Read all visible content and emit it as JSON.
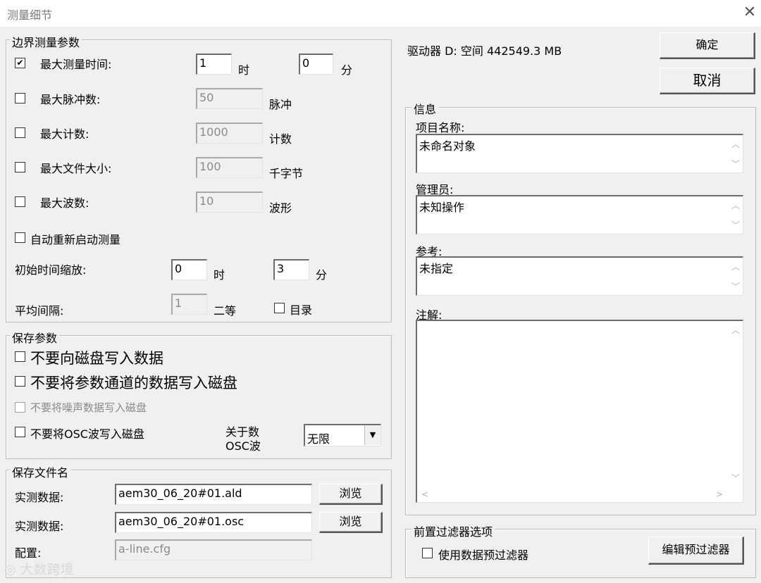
{
  "window": {
    "title": "测量细节",
    "close_icon": "close-icon"
  },
  "boundary": {
    "legend": "边界测量参数",
    "max_time": {
      "label": "最大测量时间:",
      "checked": true,
      "hours": "1",
      "hours_unit": "时",
      "minutes": "0",
      "minutes_unit": "分"
    },
    "max_pulses": {
      "label": "最大脉冲数:",
      "checked": false,
      "value": "50",
      "unit": "脉冲"
    },
    "max_count": {
      "label": "最大计数:",
      "checked": false,
      "value": "1000",
      "unit": "计数"
    },
    "max_file_size": {
      "label": "最大文件大小:",
      "checked": false,
      "value": "100",
      "unit": "千字节"
    },
    "max_waves": {
      "label": "最大波数:",
      "checked": false,
      "value": "10",
      "unit": "波形"
    },
    "auto_restart": {
      "label": "自动重新启动测量",
      "checked": false
    },
    "init_time_zoom": {
      "label": "初始时间缩放:",
      "hours": "0",
      "hours_unit": "时",
      "minutes": "3",
      "minutes_unit": "分"
    },
    "avg_interval": {
      "label": "平均间隔:",
      "value": "1",
      "unit": "二等",
      "dir_label": "目录",
      "dir_checked": false
    }
  },
  "save": {
    "legend": "保存参数",
    "no_write_data": "不要向磁盘写入数据",
    "no_write_param": "不要将参数通道的数据写入磁盘",
    "no_write_noise": "不要将噪声数据写入磁盘",
    "no_write_osc": "不要将OSC波写入磁盘",
    "osc_label_line1": "关于数",
    "osc_label_line2": "OSC波",
    "osc_select": "无限"
  },
  "files": {
    "legend": "保存文件名",
    "data1_label": "实测数据:",
    "data1_value": "aem30_06_20#01.ald",
    "data2_label": "实测数据:",
    "data2_value": "aem30_06_20#01.osc",
    "config_label": "配置:",
    "config_value": "a-line.cfg",
    "browse": "浏览"
  },
  "drive": {
    "text": "驱动器 D: 空间 442549.3 MB"
  },
  "buttons": {
    "ok": "确定",
    "cancel": "取消"
  },
  "info": {
    "legend": "信息",
    "project_label": "项目名称:",
    "project_value": "未命名对象",
    "manager_label": "管理员:",
    "manager_value": "未知操作",
    "reference_label": "参考:",
    "reference_value": "未指定",
    "notes_label": "注解:",
    "notes_value": ""
  },
  "prefilter": {
    "legend": "前置过滤器选项",
    "use_label": "使用数据预过滤器",
    "edit_button": "编辑预过滤器"
  },
  "watermark": "大数跨境"
}
